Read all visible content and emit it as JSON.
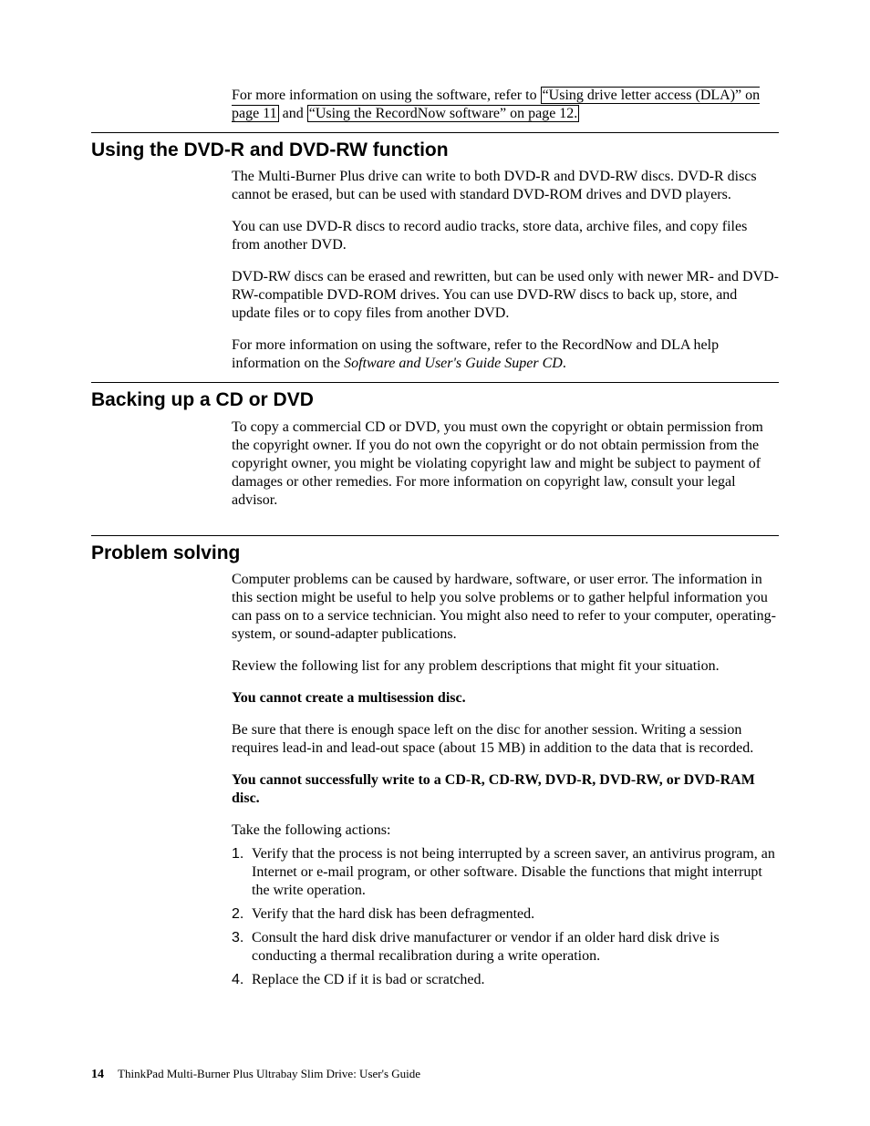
{
  "intro": {
    "text_before": "For more information on using the software, refer to ",
    "xref1": "“Using drive letter access (DLA)” on page 11",
    "text_mid": " and ",
    "xref2": "“Using the RecordNow software” on page 12."
  },
  "section1": {
    "title": "Using the DVD-R and DVD-RW function",
    "p1": "The Multi-Burner Plus drive can write to both DVD-R and DVD-RW discs. DVD-R discs cannot be erased, but can be used with standard DVD-ROM drives and DVD players.",
    "p2": "You can use DVD-R discs to record audio tracks, store data, archive files, and copy files from another DVD.",
    "p3": "DVD-RW discs can be erased and rewritten, but can be used only with newer MR- and DVD-RW-compatible DVD-ROM drives. You can use DVD-RW discs to back up, store, and update files or to copy files from another DVD.",
    "p4_a": "For more information on using the software, refer to the RecordNow and DLA help information on the ",
    "p4_i": "Software and User's Guide Super CD",
    "p4_b": "."
  },
  "section2": {
    "title": "Backing up a CD or DVD",
    "p1": "To copy a commercial CD or DVD, you must own the copyright or obtain permission from the copyright owner. If you do not own the copyright or do not obtain permission from the copyright owner, you might be violating copyright law and might be subject to payment of damages or other remedies. For more information on copyright law, consult your legal advisor."
  },
  "section3": {
    "title": "Problem solving",
    "p1": "Computer problems can be caused by hardware, software, or user error. The information in this section might be useful to help you solve problems or to gather helpful information you can pass on to a service technician. You might also need to refer to your computer, operating-system, or sound-adapter publications.",
    "p2": "Review the following list for any problem descriptions that might fit your situation.",
    "h1": "You cannot create a multisession disc.",
    "p3": "Be sure that there is enough space left on the disc for another session. Writing a session requires lead-in and lead-out space (about 15 MB) in addition to the data that is recorded.",
    "h2": "You cannot successfully write to a CD-R, CD-RW, DVD-R, DVD-RW, or DVD-RAM disc.",
    "p4": "Take the following actions:",
    "list": {
      "n1": "1.",
      "t1": "Verify that the process is not being interrupted by a screen saver, an antivirus program, an Internet or e-mail program, or other software. Disable the functions that might interrupt the write operation.",
      "n2": "2.",
      "t2": "Verify that the hard disk has been defragmented.",
      "n3": "3.",
      "t3": "Consult the hard disk drive manufacturer or vendor if an older hard disk drive is conducting a thermal recalibration during a write operation.",
      "n4": "4.",
      "t4": "Replace the CD if it is bad or scratched."
    }
  },
  "footer": {
    "page": "14",
    "doc": "ThinkPad Multi-Burner Plus Ultrabay Slim Drive: User's Guide"
  }
}
